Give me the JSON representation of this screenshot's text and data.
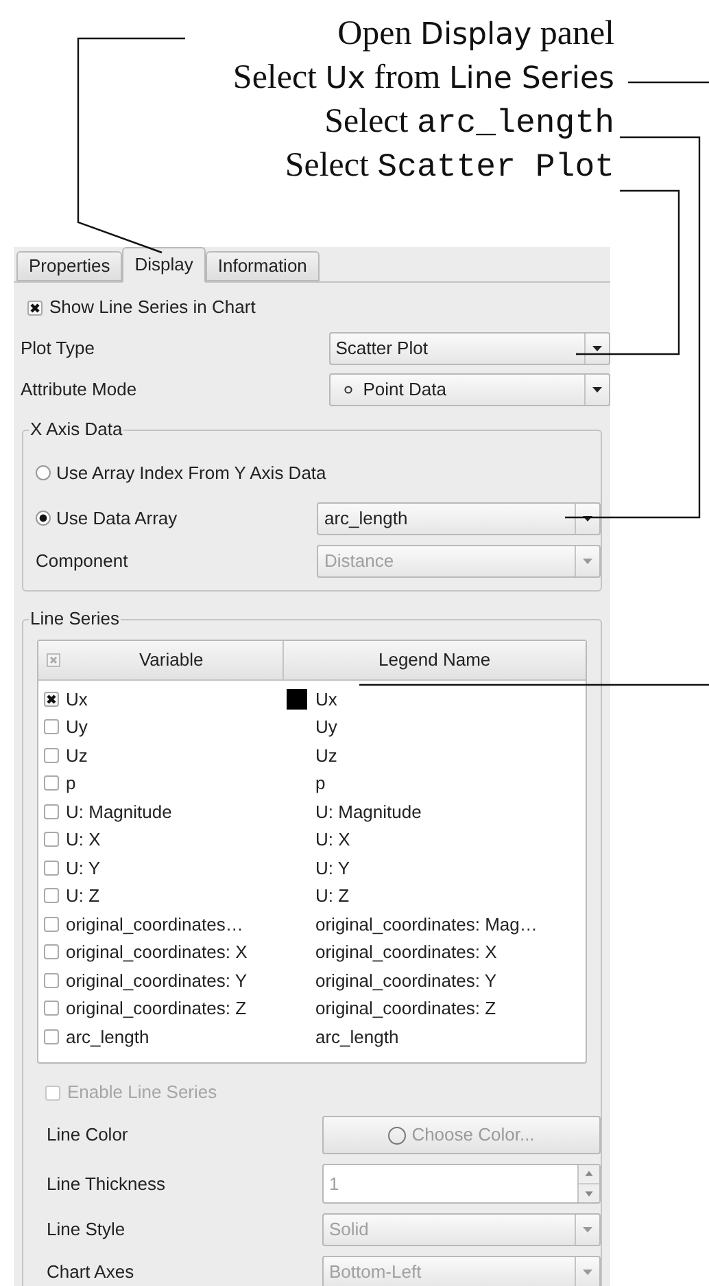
{
  "callouts": [
    {
      "parts": [
        {
          "text": "Open ",
          "kind": "serif"
        },
        {
          "text": "Display",
          "kind": "sans"
        },
        {
          "text": " panel",
          "kind": "serif"
        }
      ]
    },
    {
      "parts": [
        {
          "text": "Select ",
          "kind": "serif"
        },
        {
          "text": "Ux",
          "kind": "sans"
        },
        {
          "text": " from ",
          "kind": "serif"
        },
        {
          "text": "Line Series",
          "kind": "sans"
        }
      ]
    },
    {
      "parts": [
        {
          "text": "Select ",
          "kind": "serif"
        },
        {
          "text": "arc_length",
          "kind": "mono"
        }
      ]
    },
    {
      "parts": [
        {
          "text": "Select ",
          "kind": "serif"
        },
        {
          "text": "Scatter Plot",
          "kind": "mono"
        }
      ]
    }
  ],
  "tabs": [
    {
      "label": "Properties",
      "selected": false
    },
    {
      "label": "Display",
      "selected": true
    },
    {
      "label": "Information",
      "selected": false
    }
  ],
  "show_line_series": {
    "label": "Show Line Series in Chart",
    "checked": true
  },
  "plot_type": {
    "label": "Plot Type",
    "value": "Scatter Plot"
  },
  "attribute_mode": {
    "label": "Attribute Mode",
    "value": "Point Data"
  },
  "x_axis_data": {
    "title": "X Axis Data",
    "options": [
      {
        "label": "Use Array Index From Y Axis Data",
        "selected": false
      },
      {
        "label": "Use Data Array",
        "selected": true,
        "value": "arc_length"
      }
    ],
    "component": {
      "label": "Component",
      "value": "Distance",
      "disabled": true
    }
  },
  "line_series": {
    "title": "Line Series",
    "columns": [
      "Variable",
      "Legend Name"
    ],
    "header_checkbox": {
      "checked": true,
      "disabled": true
    },
    "rows": [
      {
        "variable": "Ux",
        "legend": "Ux",
        "checked": true,
        "color": "#000000"
      },
      {
        "variable": "Uy",
        "legend": "Uy",
        "checked": false
      },
      {
        "variable": "Uz",
        "legend": "Uz",
        "checked": false
      },
      {
        "variable": "p",
        "legend": "p",
        "checked": false
      },
      {
        "variable": "U: Magnitude",
        "legend": "U: Magnitude",
        "checked": false
      },
      {
        "variable": "U: X",
        "legend": "U: X",
        "checked": false
      },
      {
        "variable": "U: Y",
        "legend": "U: Y",
        "checked": false
      },
      {
        "variable": "U: Z",
        "legend": "U: Z",
        "checked": false
      },
      {
        "variable": "original_coordinates…",
        "legend": "original_coordinates: Mag…",
        "checked": false
      },
      {
        "variable": "original_coordinates: X",
        "legend": "original_coordinates: X",
        "checked": false
      },
      {
        "variable": "original_coordinates: Y",
        "legend": "original_coordinates: Y",
        "checked": false
      },
      {
        "variable": "original_coordinates: Z",
        "legend": "original_coordinates: Z",
        "checked": false
      },
      {
        "variable": "arc_length",
        "legend": "arc_length",
        "checked": false
      }
    ],
    "enable": {
      "label": "Enable Line Series",
      "checked": false,
      "disabled": true
    },
    "properties": [
      {
        "kind": "button",
        "label": "Line Color",
        "value": "Choose Color...",
        "disabled": true
      },
      {
        "kind": "spin",
        "label": "Line Thickness",
        "value": "1",
        "disabled": true
      },
      {
        "kind": "combo",
        "label": "Line Style",
        "value": "Solid",
        "disabled": true
      },
      {
        "kind": "combo",
        "label": "Chart Axes",
        "value": "Bottom-Left",
        "disabled": true
      }
    ]
  }
}
